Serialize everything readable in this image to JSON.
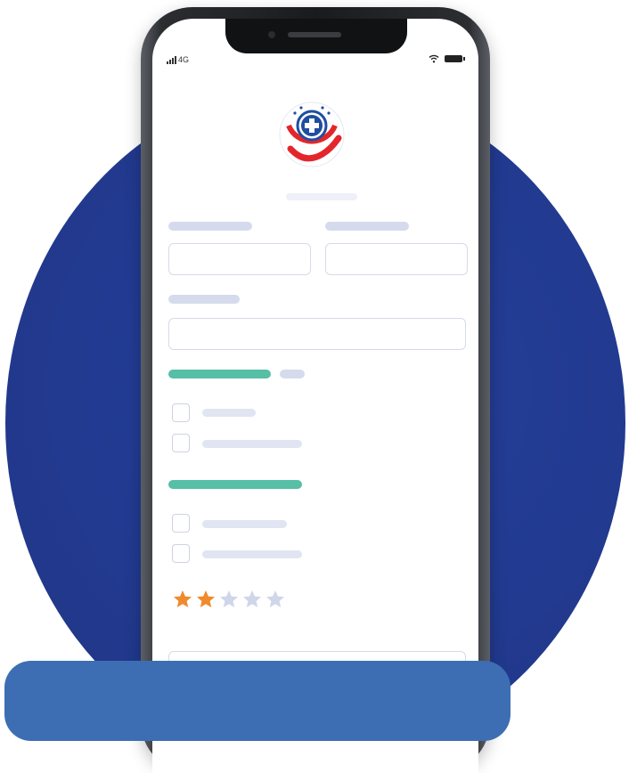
{
  "status_bar": {
    "network": "4G"
  },
  "logo": {
    "alt": "Hospital emblem"
  },
  "form": {
    "rating": {
      "value": 2,
      "max": 5
    }
  },
  "colors": {
    "background_circle": "#223a90",
    "phone_frame": "#1a1b1e",
    "teal_accent": "#56bfa6",
    "placeholder_bar": "#d5dbed",
    "star_filled": "#f08a2c",
    "star_empty": "#cfd6ea",
    "bottom_card": "#3d6eb3",
    "logo_red": "#e3262b",
    "logo_blue": "#1f4ea0"
  },
  "icons": [
    "signal-icon",
    "wifi-icon",
    "battery-icon",
    "star-icon",
    "checkbox-icon"
  ]
}
